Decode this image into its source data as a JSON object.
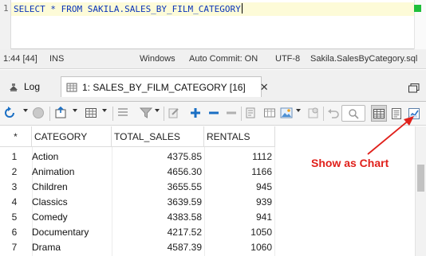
{
  "editor": {
    "line_number": "1",
    "sql": "SELECT * FROM SAKILA.SALES_BY_FILM_CATEGORY"
  },
  "status": {
    "position": "1:44 [44]",
    "mode": "INS",
    "line_endings": "Windows",
    "auto_commit": "Auto Commit: ON",
    "encoding": "UTF-8",
    "file": "Sakila.SalesByCategory.sql"
  },
  "tabs": {
    "log_label": "Log",
    "result_label": "1: SALES_BY_FILM_CATEGORY [16]",
    "close_symbol": "✕"
  },
  "grid": {
    "row_header": "*",
    "columns": [
      "CATEGORY",
      "TOTAL_SALES",
      "RENTALS"
    ],
    "rows": [
      {
        "n": "1",
        "category": "Action",
        "total_sales": "4375.85",
        "rentals": "1112"
      },
      {
        "n": "2",
        "category": "Animation",
        "total_sales": "4656.30",
        "rentals": "1166"
      },
      {
        "n": "3",
        "category": "Children",
        "total_sales": "3655.55",
        "rentals": "945"
      },
      {
        "n": "4",
        "category": "Classics",
        "total_sales": "3639.59",
        "rentals": "939"
      },
      {
        "n": "5",
        "category": "Comedy",
        "total_sales": "4383.58",
        "rentals": "941"
      },
      {
        "n": "6",
        "category": "Documentary",
        "total_sales": "4217.52",
        "rentals": "1050"
      },
      {
        "n": "7",
        "category": "Drama",
        "total_sales": "4587.39",
        "rentals": "1060"
      }
    ]
  },
  "annotation": {
    "label": "Show as Chart",
    "color": "#e0201b"
  },
  "icons": [
    "refresh-icon",
    "stop-icon",
    "export-icon",
    "grid-menu-icon",
    "filter-icon",
    "add-row-icon",
    "delete-row-icon",
    "remove-row-icon",
    "edit-icon",
    "columns-icon",
    "image-icon",
    "undo-icon",
    "search-icon",
    "grid-view-icon",
    "text-view-icon",
    "chart-view-icon"
  ]
}
